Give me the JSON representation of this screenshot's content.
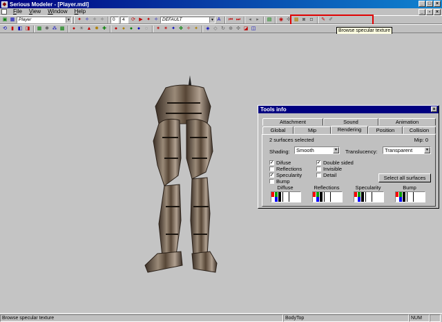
{
  "window": {
    "title": "Serious Modeler - [Player.mdl]"
  },
  "menu": [
    {
      "label": "File",
      "mnemonic": "F",
      "rest": "ile"
    },
    {
      "label": "View",
      "mnemonic": "V",
      "rest": "iew"
    },
    {
      "label": "Window",
      "mnemonic": "W",
      "rest": "indow"
    },
    {
      "label": "Help",
      "mnemonic": "H",
      "rest": "elp"
    }
  ],
  "toolbar": {
    "model_combo": "Player",
    "frame_start": "0",
    "frame_end": "4",
    "skin_combo": "DEFAULT"
  },
  "tooltip": "Browse specular texture",
  "tools_info": {
    "title": "Tools info",
    "tabs_back": [
      "Attachment",
      "Sound",
      "Animation"
    ],
    "tabs_front": [
      "Global",
      "Mip",
      "Rendering",
      "Position",
      "Collision"
    ],
    "active_tab": "Rendering",
    "surfaces_selected": "2 surfaces selected",
    "mip": "Mip: 0",
    "shading_label": "Shading:",
    "shading_value": "Smooth",
    "translucency_label": "Translucency:",
    "translucency_value": "Transparent",
    "checkboxes_left": [
      {
        "label": "Difuse",
        "checked": true
      },
      {
        "label": "Reflections",
        "checked": false
      },
      {
        "label": "Specularity",
        "checked": true
      },
      {
        "label": "Bump",
        "checked": false
      }
    ],
    "checkboxes_right": [
      {
        "label": "Double sided",
        "checked": true
      },
      {
        "label": "Invisible",
        "checked": false
      },
      {
        "label": "Detail",
        "checked": false
      }
    ],
    "select_all_button": "Select all surfaces",
    "swatches": [
      "Diffuse",
      "Reflections",
      "Specularity",
      "Bump"
    ],
    "check_mark": "✓"
  },
  "status": {
    "message": "Browse specular texture",
    "surface": "BodyTop",
    "num": "NUM"
  }
}
